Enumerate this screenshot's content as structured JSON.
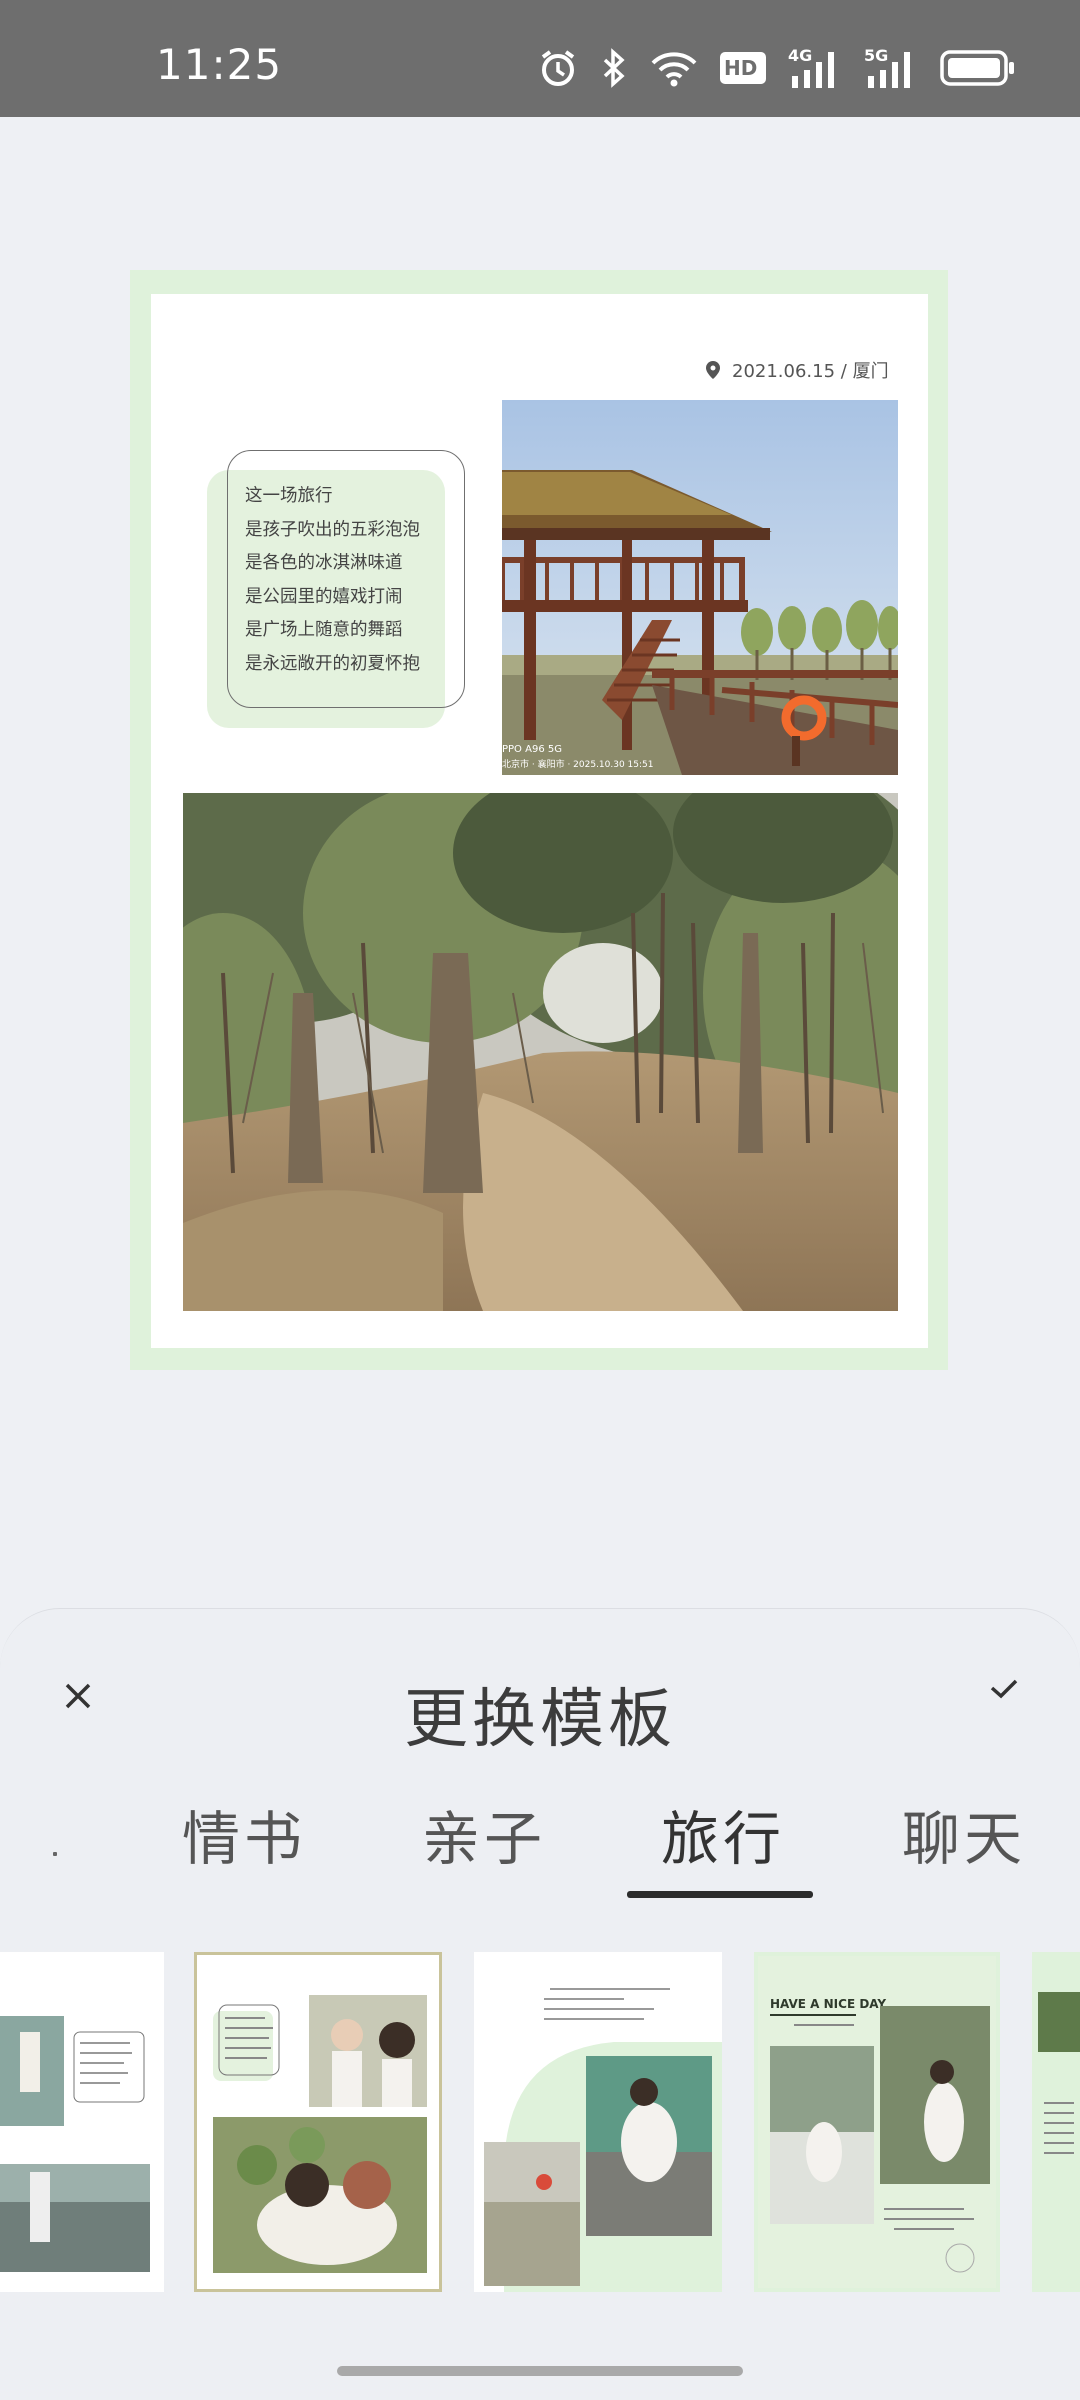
{
  "status_bar": {
    "time": "11:25",
    "icons": [
      "alarm-icon",
      "bluetooth-icon",
      "wifi-icon",
      "hd-icon",
      "signal-4g-icon",
      "signal-5g-icon",
      "battery-icon"
    ],
    "hd_label": "HD",
    "net1": "4G",
    "net2": "5G"
  },
  "preview": {
    "date_location": "2021.06.15 / 厦门",
    "poem_lines": [
      "这一场旅行",
      "是孩子吹出的五彩泡泡",
      "是各色的冰淇淋味道",
      "是公园里的嬉戏打闹",
      "是广场上随意的舞蹈",
      "是永远敞开的初夏怀抱"
    ],
    "photo1_watermark_line1": "PPO A96 5G",
    "photo1_watermark_line2": "北京市 · 襄阳市 · 2025.10.30 15:51"
  },
  "sheet": {
    "title": "更换模板",
    "tabs": [
      "情书",
      "亲子",
      "旅行",
      "聊天"
    ],
    "active_tab": "旅行",
    "thumb4_heading": "HAVE A NICE DAY"
  },
  "colors": {
    "card_border": "#dff2db",
    "poem_bg": "#e4f2de",
    "sheet_bg": "#edeff3",
    "selected_border": "#c9c39a",
    "tab_underline": "#2c2c2c"
  }
}
